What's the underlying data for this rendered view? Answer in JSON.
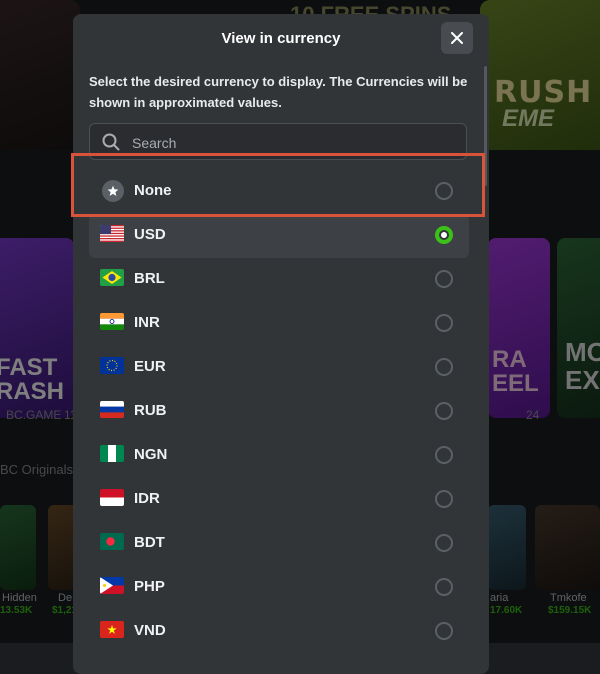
{
  "background": {
    "banner_top_text": "10 FREE SPINS",
    "banner_title": "RUSH",
    "banner_subtitle": "EME",
    "card_left_title": "FAST\nRASH",
    "card_left_brand": "BC.GAME",
    "card_left_players": "11",
    "card_mid_title": "RA\nEEL",
    "card_mid_players": "24",
    "card_right_title": "MO\nEXP",
    "section_title": "BC Originals",
    "small_cards": [
      {
        "label": "Hidden",
        "value": "13.53K"
      },
      {
        "label": "De",
        "value": "$1,21"
      },
      {
        "label": "aria",
        "value": "17.60K"
      },
      {
        "label": "Tmkofe",
        "value": "$159.15K"
      }
    ]
  },
  "modal": {
    "title": "View in currency",
    "description": "Select the desired currency to display. The Currencies will be shown in approximated values.",
    "search_placeholder": "Search",
    "selected": "USD",
    "currencies": [
      {
        "code": "None",
        "icon": "star-icon"
      },
      {
        "code": "USD",
        "icon": "us-flag-icon"
      },
      {
        "code": "BRL",
        "icon": "brazil-flag-icon"
      },
      {
        "code": "INR",
        "icon": "india-flag-icon"
      },
      {
        "code": "EUR",
        "icon": "eu-flag-icon"
      },
      {
        "code": "RUB",
        "icon": "russia-flag-icon"
      },
      {
        "code": "NGN",
        "icon": "nigeria-flag-icon"
      },
      {
        "code": "IDR",
        "icon": "indonesia-flag-icon"
      },
      {
        "code": "BDT",
        "icon": "bangladesh-flag-icon"
      },
      {
        "code": "PHP",
        "icon": "philippines-flag-icon"
      },
      {
        "code": "VND",
        "icon": "vietnam-flag-icon"
      }
    ]
  },
  "colors": {
    "accent_green": "#3bc117",
    "highlight_box": "#d9533a",
    "modal_bg": "#323538"
  }
}
